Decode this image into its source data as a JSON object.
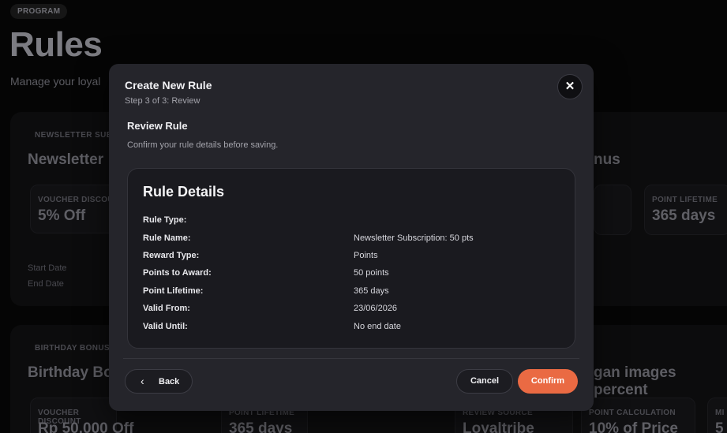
{
  "background": {
    "badge": "PROGRAM",
    "title": "Rules",
    "subtitle": "Manage your loyal",
    "card1": {
      "label": "NEWSLETTER SUB",
      "heading": "Newsletter",
      "heading_right": "nus",
      "tile1": {
        "label": "VOUCHER DISCOU",
        "value": "5% Off"
      },
      "tile2": {
        "label": "POINT LIFETIME",
        "value": "365 days"
      },
      "start_label": "Start Date",
      "end_label": "End Date"
    },
    "card2": {
      "label": "BIRTHDAY BONUS",
      "heading": "Birthday Bo",
      "heading_right": "gan images percent",
      "tiles": [
        {
          "label": "VOUCHER DISCOUNT",
          "value": "Rp 50.000 Off"
        },
        {
          "label": "POINT LIFETIME",
          "value": "365 days"
        },
        {
          "label": "REVIEW SOURCE",
          "value": "Loyaltribe"
        },
        {
          "label": "POINT CALCULATION",
          "value": "10% of Price"
        },
        {
          "label": "MI",
          "value": "5"
        }
      ]
    }
  },
  "modal": {
    "title": "Create New Rule",
    "step": "Step 3 of 3: Review",
    "close_glyph": "✕",
    "section_title": "Review Rule",
    "section_sub": "Confirm your rule details before saving.",
    "details_title": "Rule Details",
    "rows": [
      {
        "key": "Rule Type:",
        "value": ""
      },
      {
        "key": "Rule Name:",
        "value": "Newsletter Subscription: 50 pts"
      },
      {
        "key": "Reward Type:",
        "value": "Points"
      },
      {
        "key": "Points to Award:",
        "value": "50 points"
      },
      {
        "key": "Point Lifetime:",
        "value": "365 days"
      },
      {
        "key": "Valid From:",
        "value": "23/06/2026"
      },
      {
        "key": "Valid Until:",
        "value": "No end date"
      }
    ],
    "back_glyph": "‹",
    "back_label": "Back",
    "cancel_label": "Cancel",
    "confirm_label": "Confirm",
    "accent_color": "#ea6a43"
  }
}
